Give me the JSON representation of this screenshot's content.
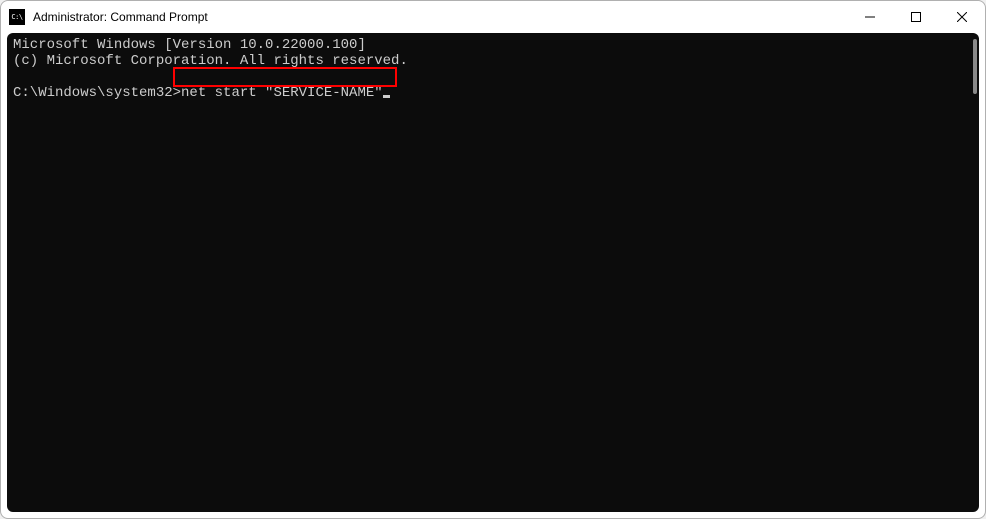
{
  "window": {
    "title": "Administrator: Command Prompt"
  },
  "terminal": {
    "line1": "Microsoft Windows [Version 10.0.22000.100]",
    "line2": "(c) Microsoft Corporation. All rights reserved.",
    "prompt": "C:\\Windows\\system32>",
    "command": "net start \"SERVICE-NAME\""
  }
}
